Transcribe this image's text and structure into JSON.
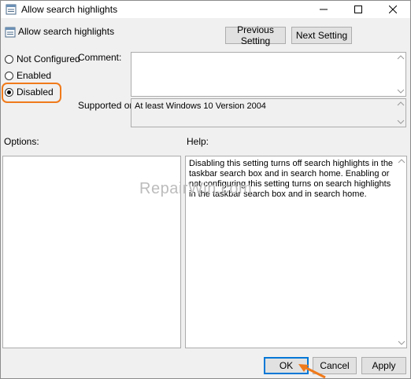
{
  "window": {
    "title": "Allow search highlights"
  },
  "header": {
    "title": "Allow search highlights",
    "prev_label": "Previous Setting",
    "next_label": "Next Setting"
  },
  "state": {
    "options": [
      {
        "label": "Not Configured",
        "checked": false
      },
      {
        "label": "Enabled",
        "checked": false
      },
      {
        "label": "Disabled",
        "checked": true
      }
    ]
  },
  "comment": {
    "label": "Comment:",
    "value": ""
  },
  "supported": {
    "label": "Supported on:",
    "value": "At least Windows 10 Version 2004"
  },
  "options_panel": {
    "label": "Options:"
  },
  "help": {
    "label": "Help:",
    "text": "Disabling this setting turns off search highlights in the taskbar search box and in search home. Enabling or not configuring this setting turns on search highlights in the taskbar search box and in search home."
  },
  "watermark": "RepairWin.com",
  "footer": {
    "ok_label": "OK",
    "cancel_label": "Cancel",
    "apply_label": "Apply"
  },
  "colors": {
    "highlight": "#f07a1a",
    "default_button_border": "#0078d7"
  }
}
